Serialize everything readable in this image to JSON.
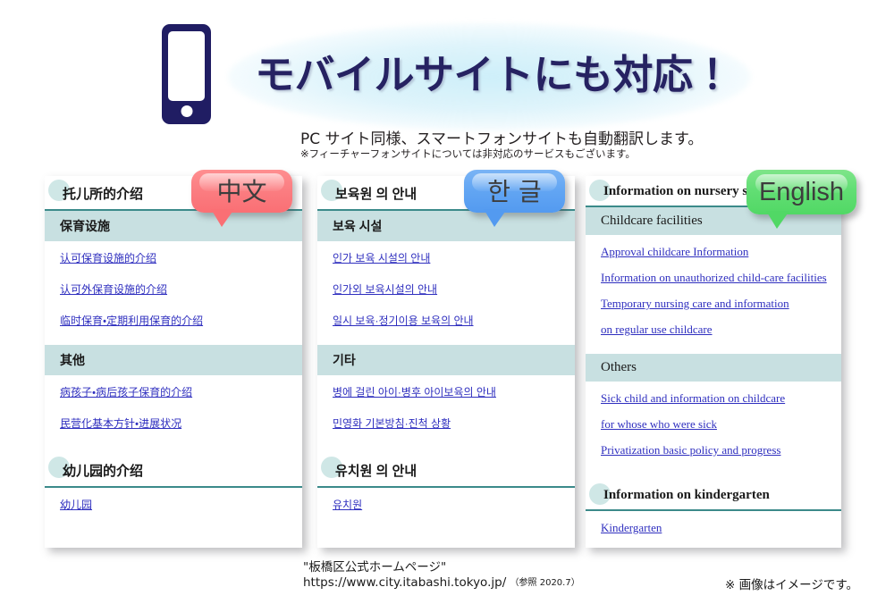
{
  "hero": {
    "title": "モバイルサイトにも対応！",
    "subtitle": "PC サイト同様、スマートフォンサイトも自動翻訳します。",
    "note": "※フィーチャーフォンサイトについては非対応のサービスもございます。",
    "phone_icon": "mobile-phone-icon",
    "title_color": "#262262",
    "glow_color": "#cbeef9"
  },
  "bubbles": [
    {
      "id": "zh",
      "label": "中文",
      "color": "#fb7e82"
    },
    {
      "id": "ko",
      "label": "한 글",
      "color": "#63a6f3"
    },
    {
      "id": "en",
      "label": "English",
      "color": "#62de74"
    }
  ],
  "panels": [
    {
      "id": "zh",
      "language": "Chinese",
      "sections": [
        {
          "heading": "托儿所的介绍",
          "groups": [
            {
              "subheading": "保育设施",
              "links": [
                "认可保育设施的介绍",
                "认可外保育设施的介绍",
                "临时保育・定期利用保育的介绍"
              ]
            },
            {
              "subheading": "其他",
              "links": [
                "病孩子・病后孩子保育的介绍",
                "民营化基本方针・进展状况"
              ]
            }
          ]
        },
        {
          "heading": "幼儿园的介绍",
          "groups": [
            {
              "subheading": "",
              "links": [
                "幼儿园"
              ]
            }
          ]
        }
      ]
    },
    {
      "id": "ko",
      "language": "Korean",
      "sections": [
        {
          "heading": "보육원 의 안내",
          "groups": [
            {
              "subheading": "보육 시설",
              "links": [
                "인가 보육 시설의 안내",
                "인가외 보육시설의 안내",
                "일시 보육·정기이용 보육의 안내"
              ]
            },
            {
              "subheading": "기타",
              "links": [
                "병에 걸린 아이·병후 아이보육의 안내",
                "민영화 기본방침·진척 상황"
              ]
            }
          ]
        },
        {
          "heading": "유치원 의 안내",
          "groups": [
            {
              "subheading": "",
              "links": [
                "유치원"
              ]
            }
          ]
        }
      ]
    },
    {
      "id": "en",
      "language": "English",
      "sections": [
        {
          "heading": "Information on nursery s",
          "groups": [
            {
              "subheading": "Childcare facilities",
              "links": [
                "Approval childcare Information",
                "Information on unauthorized child-care facilities",
                "Temporary nursing care and information",
                "on regular use childcare"
              ]
            },
            {
              "subheading": "Others",
              "links": [
                "Sick child and information on childcare",
                "for whose who were sick",
                "Privatization basic policy and progress"
              ]
            }
          ]
        },
        {
          "heading": "Information on kindergarten",
          "groups": [
            {
              "subheading": "",
              "links": [
                "Kindergarten"
              ]
            }
          ]
        }
      ]
    }
  ],
  "footer": {
    "source_title": "\"板橋区公式ホームページ\"",
    "source_url": "https://www.city.itabashi.tokyo.jp/",
    "source_ref": "（参照 2020.7）",
    "disclaimer": "※ 画像はイメージです。"
  }
}
